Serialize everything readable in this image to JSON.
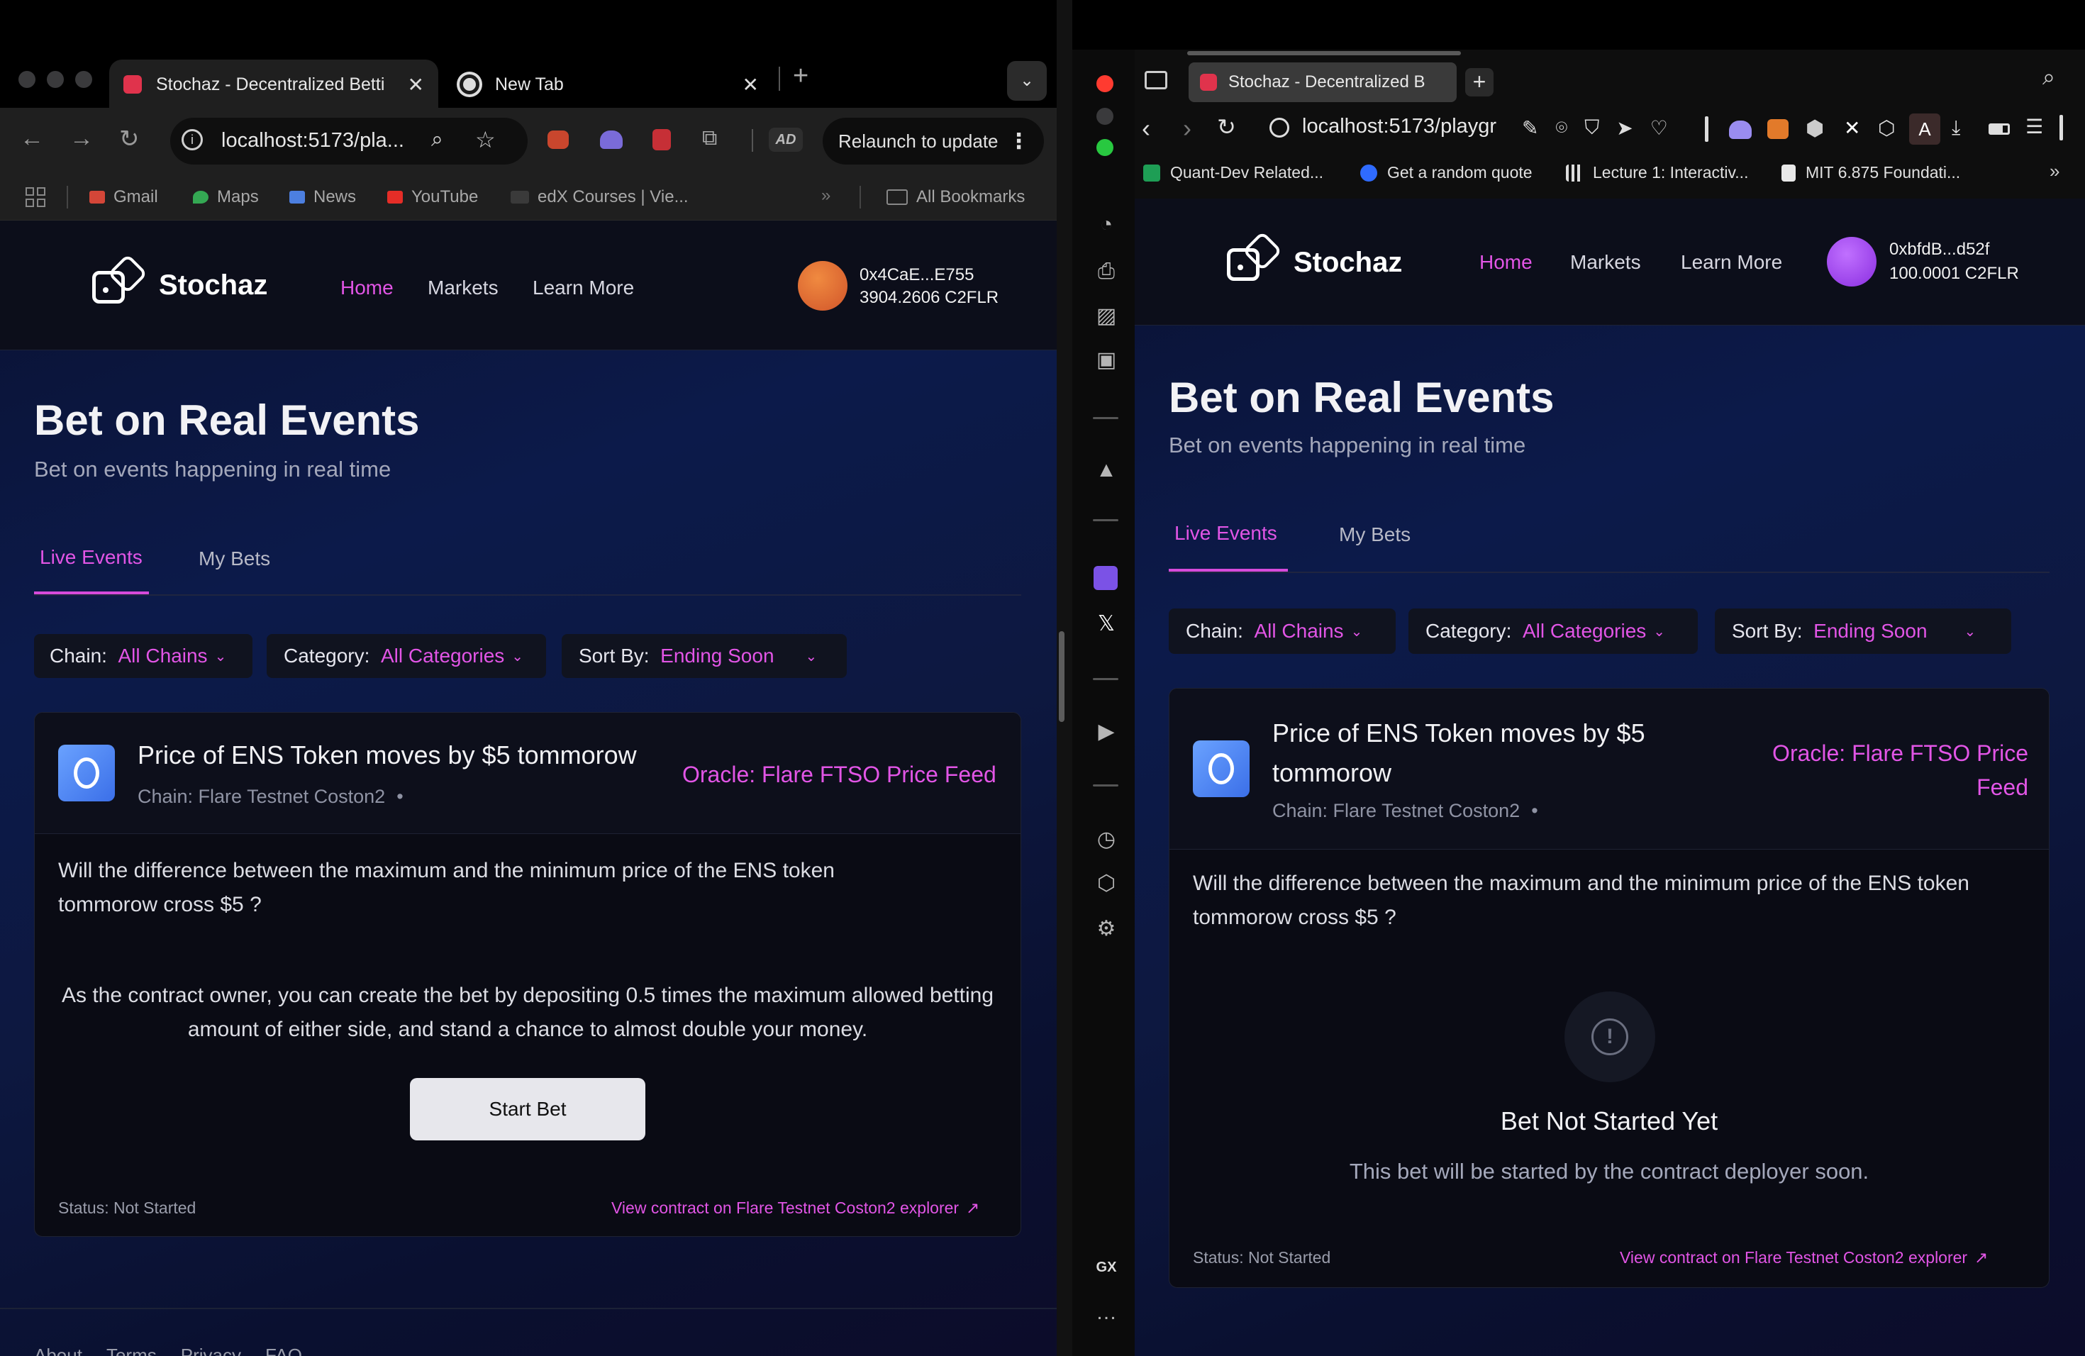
{
  "left_browser": {
    "tabs": [
      {
        "title": "Stochaz - Decentralized Betti"
      },
      {
        "title": "New Tab"
      }
    ],
    "address": "localhost:5173/pla...",
    "relaunch_label": "Relaunch to update",
    "bookmarks": [
      "Gmail",
      "Maps",
      "News",
      "YouTube",
      "edX Courses | Vie...",
      "All Bookmarks"
    ]
  },
  "right_browser": {
    "tab_title": "Stochaz - Decentralized B",
    "address": "localhost:5173/playgr",
    "bookmarks": [
      "Quant-Dev Related...",
      "Get a random quote",
      "Lecture 1: Interactiv...",
      "MIT 6.875 Foundati..."
    ],
    "sidebar_label": "GX"
  },
  "app": {
    "brand": "Stochaz",
    "nav": [
      "Home",
      "Markets",
      "Learn More"
    ],
    "hero_title": "Bet on Real Events",
    "hero_subtitle": "Bet on events happening in real time",
    "tabs": [
      "Live Events",
      "My Bets"
    ],
    "filters": {
      "chain_label": "Chain:",
      "chain_value": "All Chains",
      "category_label": "Category:",
      "category_value": "All Categories",
      "sort_label": "Sort By:",
      "sort_value": "Ending Soon"
    },
    "card": {
      "title": "Price of ENS Token moves by $5 tommorow",
      "chain": "Chain: Flare Testnet Coston2",
      "oracle": "Oracle: Flare FTSO Price Feed",
      "question": "Will the difference between the maximum and the minimum price of the ENS token tommorow cross $5 ?",
      "owner_note": "As the contract owner, you can create the bet by depositing 0.5 times the maximum allowed betting amount of either side, and stand a chance to almost double your money.",
      "start_button": "Start Bet",
      "status": "Status: Not Started",
      "explorer_link": "View contract on Flare Testnet Coston2 explorer",
      "not_started_title": "Bet Not Started Yet",
      "not_started_text": "This bet will be started by the contract deployer soon."
    },
    "left_wallet": {
      "address": "0x4CaE...E755",
      "balance": "3904.2606 C2FLR"
    },
    "right_wallet": {
      "address": "0xbfdB...d52f",
      "balance": "100.0001 C2FLR"
    },
    "footer": [
      "About",
      "Terms",
      "Privacy",
      "FAQ"
    ]
  },
  "colors": {
    "accent": "#e255e6",
    "bg": "#0a1233",
    "card": "#0a0b14"
  }
}
